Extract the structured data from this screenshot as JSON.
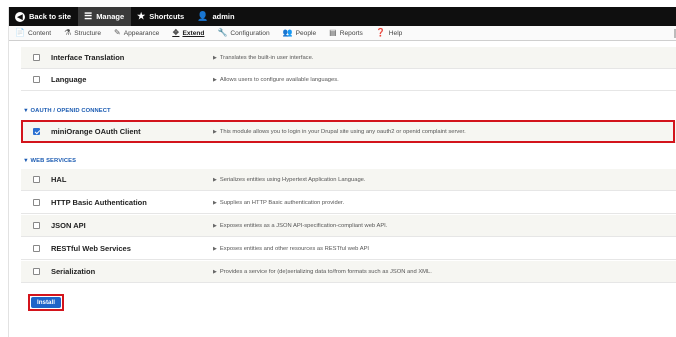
{
  "toolbar": {
    "back_to_site": "Back to site",
    "manage": "Manage",
    "shortcuts": "Shortcuts",
    "user": "admin"
  },
  "tray": {
    "items": [
      "Content",
      "Structure",
      "Appearance",
      "Extend",
      "Configuration",
      "People",
      "Reports",
      "Help"
    ],
    "active": "Extend"
  },
  "modules": {
    "interface_translation": {
      "name": "Interface Translation",
      "desc": "Translates the built-in user interface."
    },
    "language": {
      "name": "Language",
      "desc": "Allows users to configure available languages."
    },
    "oauth_section": "▼ OAUTH / OPENID CONNECT",
    "miniorange": {
      "name": "miniOrange OAuth Client",
      "desc": "This module allows you to login in your Drupal site using any oauth2 or openid complaint server.",
      "checked": true
    },
    "web_services_section": "▼ WEB SERVICES",
    "hal": {
      "name": "HAL",
      "desc": "Serializes entities using Hypertext Application Language."
    },
    "http_basic": {
      "name": "HTTP Basic Authentication",
      "desc": "Supplies an HTTP Basic authentication provider."
    },
    "json_api": {
      "name": "JSON API",
      "desc": "Exposes entities as a JSON API-specification-compliant web API."
    },
    "restful": {
      "name": "RESTful Web Services",
      "desc": "Exposes entities and other resources as RESTful web API"
    },
    "serialization": {
      "name": "Serialization",
      "desc": "Provides a service for (de)serializing data to/from formats such as JSON and XML."
    }
  },
  "install_label": "Install",
  "colors": {
    "toolbar_bg": "#0f0f0f",
    "section_link": "#1b5bb2",
    "highlight": "#d3141c",
    "install_button": "#1f64c8"
  },
  "icons": {
    "back": "arrow-left-icon",
    "manage": "hamburger-menu-icon",
    "shortcuts": "star-icon",
    "user": "user-icon"
  }
}
